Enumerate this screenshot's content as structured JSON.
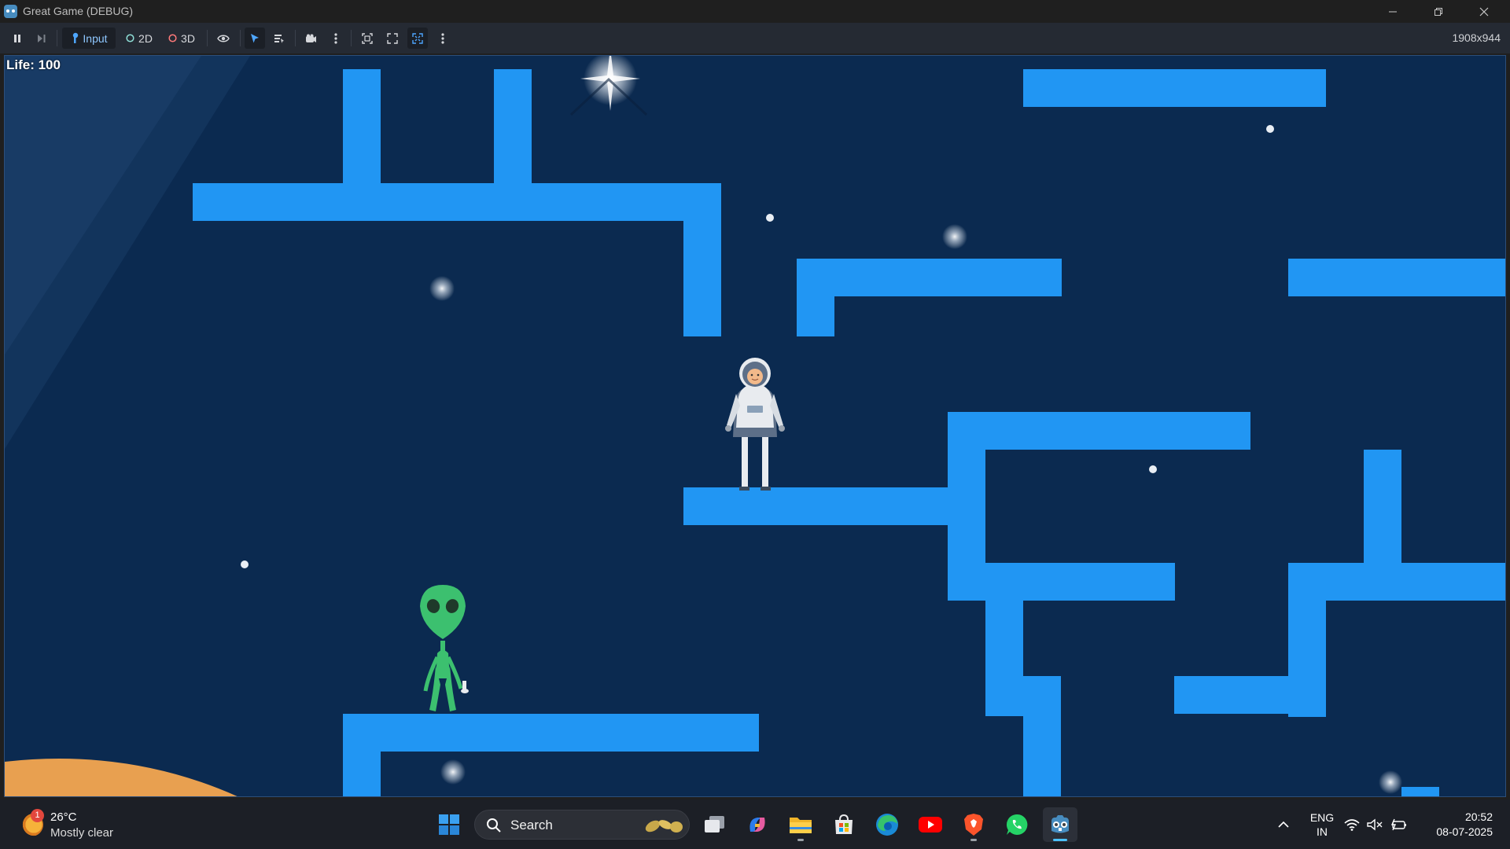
{
  "window": {
    "title": "Great Game (DEBUG)",
    "controls": [
      "minimize",
      "restore",
      "close"
    ]
  },
  "toolbar": {
    "buttons": [
      {
        "name": "pause-icon",
        "active": false
      },
      {
        "name": "step-frame-icon",
        "active": false
      },
      {
        "name": "input-button",
        "label": "Input",
        "active": true
      },
      {
        "name": "2d-button",
        "label": "2D",
        "active": false
      },
      {
        "name": "3d-button",
        "label": "3D",
        "active": false
      },
      {
        "name": "visibility-eye-icon",
        "active": false
      },
      {
        "name": "select-arrow-icon",
        "active": true
      },
      {
        "name": "list-select-icon",
        "active": false
      },
      {
        "name": "camera-icon",
        "active": false
      },
      {
        "name": "more-vertical-icon",
        "active": false
      },
      {
        "name": "camera-focus-icon",
        "active": false
      },
      {
        "name": "fit-screen-icon",
        "active": false
      },
      {
        "name": "fullscreen-icon",
        "active": true
      },
      {
        "name": "more-vertical-icon",
        "active": false
      }
    ],
    "resolution": "1908x944"
  },
  "hud": {
    "life_label": "Life: 100"
  },
  "game": {
    "background_color": "#0b2a50",
    "platform_color": "#2196f3",
    "planet_color": "#e8a050",
    "alien_color": "#3cc06f",
    "characters": [
      "astronaut",
      "green-alien"
    ]
  },
  "taskbar": {
    "weather": {
      "badge": "1",
      "temperature": "26°C",
      "condition": "Mostly clear"
    },
    "search_label": "Search",
    "apps": [
      "windows-start-icon",
      "task-view-icon",
      "copilot-icon",
      "file-explorer-icon",
      "microsoft-store-icon",
      "edge-browser-icon",
      "youtube-icon",
      "brave-browser-icon",
      "whatsapp-icon",
      "godot-engine-icon"
    ],
    "language": {
      "line1": "ENG",
      "line2": "IN"
    },
    "clock": {
      "time": "20:52",
      "date": "08-07-2025"
    }
  }
}
